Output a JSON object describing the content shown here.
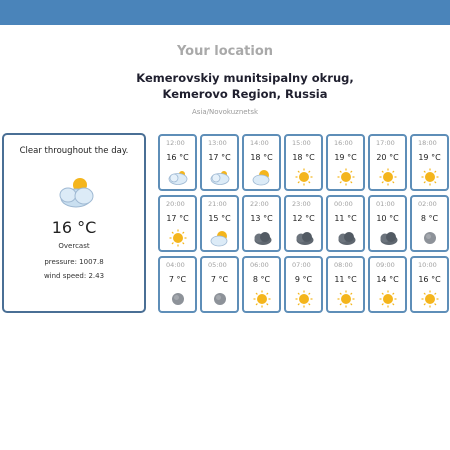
{
  "header": {
    "title": "Your location"
  },
  "location": {
    "name": "Kemerovskiy munitsipalny okrug, Kemerovo Region, Russia",
    "timezone": "Asia/Novokuznetsk"
  },
  "current": {
    "summary": "Clear throughout the day.",
    "temperature": "16 °C",
    "condition": "Overcast",
    "pressure": "pressure: 1007.8",
    "wind": "wind speed: 2.43",
    "icon": "few-clouds-icon"
  },
  "hourly": [
    {
      "time": "12:00",
      "temp": "16 °C",
      "icon": "few-clouds-icon"
    },
    {
      "time": "13:00",
      "temp": "17 °C",
      "icon": "few-clouds-icon"
    },
    {
      "time": "14:00",
      "temp": "18 °C",
      "icon": "partly-sunny-icon"
    },
    {
      "time": "15:00",
      "temp": "18 °C",
      "icon": "sun-icon"
    },
    {
      "time": "16:00",
      "temp": "19 °C",
      "icon": "sun-icon"
    },
    {
      "time": "17:00",
      "temp": "20 °C",
      "icon": "sun-icon"
    },
    {
      "time": "18:00",
      "temp": "19 °C",
      "icon": "sun-icon"
    },
    {
      "time": "20:00",
      "temp": "17 °C",
      "icon": "sun-icon"
    },
    {
      "time": "21:00",
      "temp": "15 °C",
      "icon": "partly-sunny-icon"
    },
    {
      "time": "22:00",
      "temp": "13 °C",
      "icon": "dark-clouds-icon"
    },
    {
      "time": "23:00",
      "temp": "12 °C",
      "icon": "dark-clouds-icon"
    },
    {
      "time": "00:00",
      "temp": "11 °C",
      "icon": "dark-clouds-icon"
    },
    {
      "time": "01:00",
      "temp": "10 °C",
      "icon": "dark-clouds-icon"
    },
    {
      "time": "02:00",
      "temp": "8 °C",
      "icon": "moon-icon"
    },
    {
      "time": "04:00",
      "temp": "7 °C",
      "icon": "moon-icon"
    },
    {
      "time": "05:00",
      "temp": "7 °C",
      "icon": "moon-icon"
    },
    {
      "time": "06:00",
      "temp": "8 °C",
      "icon": "sun-icon"
    },
    {
      "time": "07:00",
      "temp": "9 °C",
      "icon": "sun-icon"
    },
    {
      "time": "08:00",
      "temp": "11 °C",
      "icon": "sun-icon"
    },
    {
      "time": "09:00",
      "temp": "14 °C",
      "icon": "sun-icon"
    },
    {
      "time": "10:00",
      "temp": "16 °C",
      "icon": "sun-icon"
    }
  ],
  "colors": {
    "topbar": "#4a84ba",
    "card_border": "#4a6f95",
    "cell_border": "#5e8eb8",
    "sun": "#f4b51c",
    "cloud": "#c9dff0",
    "dark_cloud": "#5f6770",
    "moon": "#8d9299"
  }
}
